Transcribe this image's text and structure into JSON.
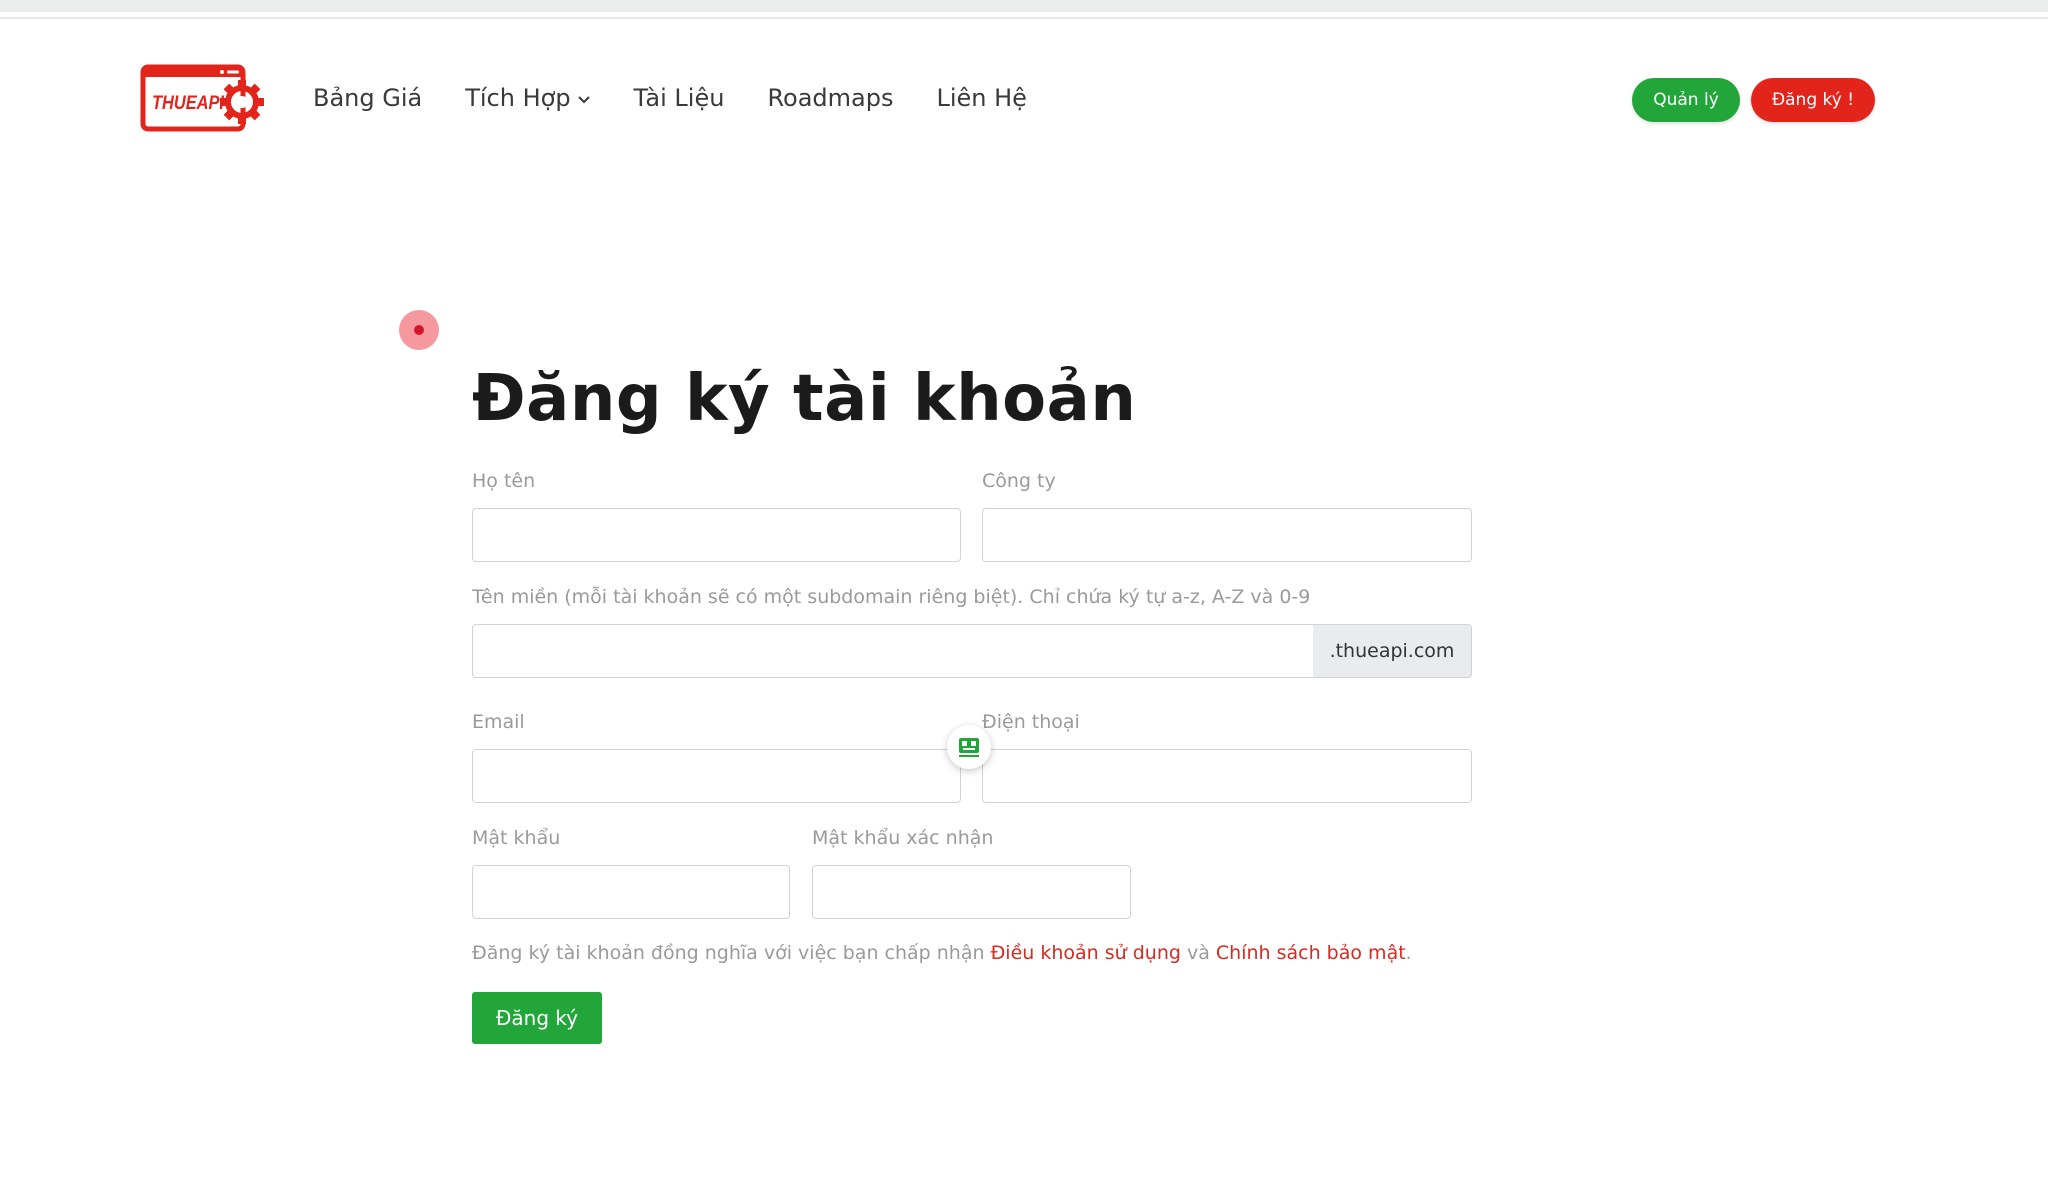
{
  "header": {
    "logo_text": "THUEAPI",
    "nav": [
      {
        "label": "Bảng Giá"
      },
      {
        "label": "Tích Hợp",
        "has_dropdown": true
      },
      {
        "label": "Tài Liệu"
      },
      {
        "label": "Roadmaps"
      },
      {
        "label": "Liên Hệ"
      }
    ],
    "manage_label": "Quản lý",
    "signup_label": "Đăng ký !"
  },
  "form": {
    "title": "Đăng ký tài khoản",
    "fullname": {
      "label": "Họ tên",
      "value": ""
    },
    "company": {
      "label": "Công ty",
      "value": ""
    },
    "domain": {
      "label": "Tên miền (mỗi tài khoản sẽ có một subdomain riêng biệt). Chỉ chứa ký tự a-z, A-Z và 0-9",
      "value": "",
      "suffix": ".thueapi.com"
    },
    "email": {
      "label": "Email",
      "value": ""
    },
    "phone": {
      "label": "Điện thoại",
      "value": ""
    },
    "password": {
      "label": "Mật khẩu",
      "value": ""
    },
    "password_confirm": {
      "label": "Mật khẩu xác nhận",
      "value": ""
    },
    "terms": {
      "prefix": "Đăng ký tài khoản đồng nghĩa với việc bạn chấp nhận ",
      "terms_link": "Điều khoản sử dụng",
      "conjunction": " và ",
      "privacy_link": "Chính sách bảo mật",
      "suffix": "."
    },
    "submit_label": "Đăng ký"
  },
  "colors": {
    "brand_red": "#e3241b",
    "brand_green": "#22a63a",
    "link_red": "#d42b22"
  },
  "icons": {
    "logo": "thueapi-logo-gear-icon",
    "nav_dropdown": "chevron-down-icon",
    "chat": "chat-bot-icon",
    "cursor": "cursor-click-marker"
  }
}
